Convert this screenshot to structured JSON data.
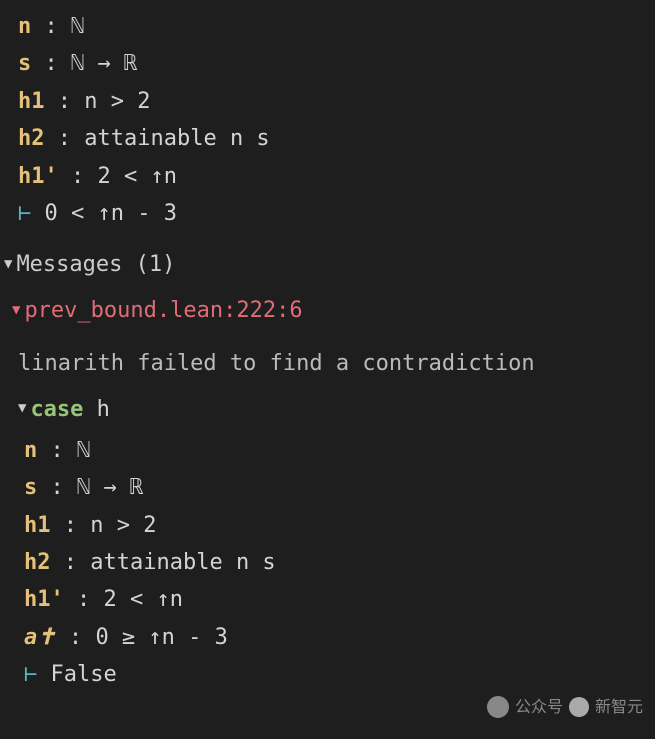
{
  "goal_state": {
    "hyps": [
      {
        "name": "n",
        "type": "ℕ"
      },
      {
        "name": "s",
        "type": "ℕ → ℝ"
      },
      {
        "name": "h1",
        "type": "n > 2"
      },
      {
        "name": "h2",
        "type": "attainable n s"
      },
      {
        "name": "h1'",
        "type": "2 < ↑n"
      }
    ],
    "turnstile": "⊢",
    "goal": "0 < ↑n - 3"
  },
  "messages": {
    "header": "Messages (1)",
    "error_loc": "prev_bound.lean:222:6",
    "error_text": "linarith failed to find a contradiction"
  },
  "case": {
    "keyword": "case",
    "name": "h",
    "hyps": [
      {
        "name": "n",
        "type": "ℕ"
      },
      {
        "name": "s",
        "type": "ℕ → ℝ"
      },
      {
        "name": "h1",
        "type": "n > 2"
      },
      {
        "name": "h2",
        "type": "attainable n s"
      },
      {
        "name": "h1'",
        "type": "2 < ↑n"
      },
      {
        "name": "a✝",
        "type": "0 ≥ ↑n - 3",
        "italic": true
      }
    ],
    "turnstile": "⊢",
    "goal": "False"
  },
  "watermark": {
    "label1": "公众号",
    "label2": "新智元"
  }
}
